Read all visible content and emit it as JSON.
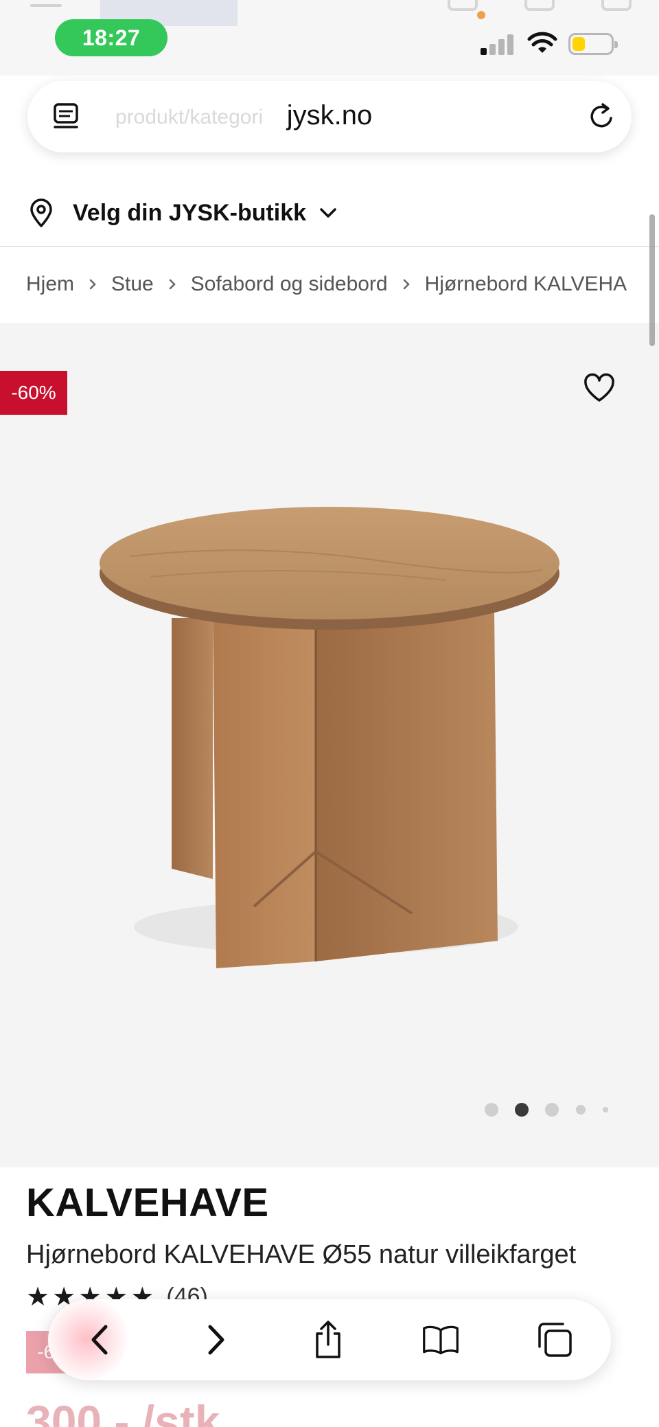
{
  "status_bar": {
    "time": "18:27"
  },
  "address_bar": {
    "domain": "jysk.no",
    "faded_placeholder": "produkt/kategori"
  },
  "store_selector": {
    "label": "Velg din JYSK-butikk"
  },
  "breadcrumb": {
    "items": [
      "Hjem",
      "Stue",
      "Sofabord og sidebord",
      "Hjørnebord KALVEHA"
    ]
  },
  "product": {
    "discount_badge": "-60%",
    "brand": "KALVEHAVE",
    "name": "Hjørnebord KALVEHAVE Ø55 natur villeikfarget",
    "rating_stars": 5,
    "review_count": "(46)",
    "price_partial": "300,- /stk",
    "image_pager": {
      "total": 5,
      "active_index": 1
    }
  },
  "colors": {
    "time_pill": "#34c759",
    "discount_red": "#c8102e",
    "battery": "#ffd400"
  },
  "icons": {
    "reader": "reader-icon",
    "reload": "reload-icon",
    "location": "location-pin-icon",
    "chevron": "chevron-down-icon",
    "favorite": "heart-icon",
    "back": "back-arrow-icon",
    "forward": "forward-arrow-icon",
    "share": "share-icon",
    "bookmarks": "book-icon",
    "tabs": "tabs-icon"
  }
}
